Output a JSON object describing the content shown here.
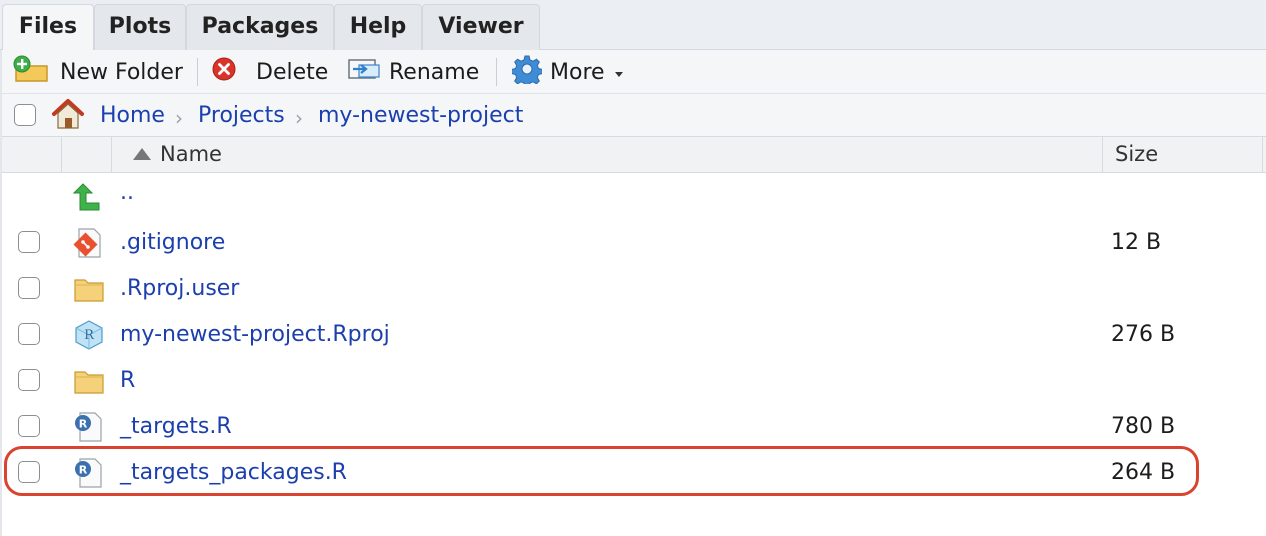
{
  "tabs": [
    {
      "label": "Files",
      "active": true
    },
    {
      "label": "Plots",
      "active": false
    },
    {
      "label": "Packages",
      "active": false
    },
    {
      "label": "Help",
      "active": false
    },
    {
      "label": "Viewer",
      "active": false
    }
  ],
  "toolbar": {
    "new_folder": {
      "label": "New Folder",
      "icon": "new-folder-icon"
    },
    "delete": {
      "label": "Delete",
      "icon": "delete-icon"
    },
    "rename": {
      "label": "Rename",
      "icon": "rename-icon"
    },
    "more": {
      "label": "More",
      "icon": "gear-icon"
    }
  },
  "breadcrumb": [
    "Home",
    "Projects",
    "my-newest-project"
  ],
  "columns": {
    "name": "Name",
    "size": "Size",
    "sort": "ascending"
  },
  "files": [
    {
      "name": "..",
      "type": "parent-directory",
      "size": "",
      "checkbox": false
    },
    {
      "name": ".gitignore",
      "type": "git-file",
      "size": "12 B",
      "checkbox": true
    },
    {
      "name": ".Rproj.user",
      "type": "folder",
      "size": "",
      "checkbox": true
    },
    {
      "name": "my-newest-project.Rproj",
      "type": "rproj-file",
      "size": "276 B",
      "checkbox": true
    },
    {
      "name": "R",
      "type": "folder",
      "size": "",
      "checkbox": true
    },
    {
      "name": "_targets.R",
      "type": "r-script",
      "size": "780 B",
      "checkbox": true
    },
    {
      "name": "_targets_packages.R",
      "type": "r-script",
      "size": "264 B",
      "checkbox": true,
      "highlighted": true
    }
  ],
  "colors": {
    "link": "#1c3fae",
    "highlight": "#d9432f",
    "toolbar_bg": "#f4f6f8",
    "tab_bg": "#e4e8ed"
  }
}
